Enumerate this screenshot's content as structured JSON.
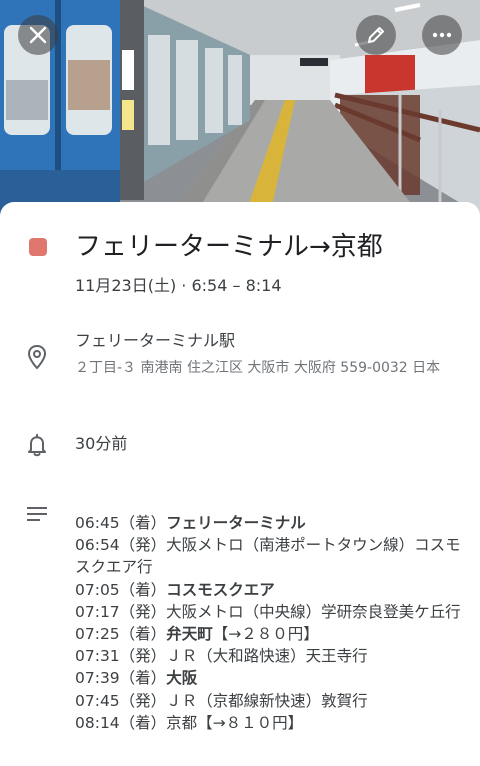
{
  "header": {
    "close_icon": "close-icon",
    "edit_icon": "pencil-icon",
    "more_icon": "more-horizontal-icon",
    "photo": "train-station-platform"
  },
  "event": {
    "color": "#e0776f",
    "title": "フェリーターミナル→京都",
    "datetime": "11月23日(土) · 6:54 – 8:14"
  },
  "location": {
    "icon": "location-pin-icon",
    "name": "フェリーターミナル駅",
    "address": "２丁目-３ 南港南 住之江区 大阪市 大阪府 559-0032 日本"
  },
  "reminder": {
    "icon": "bell-icon",
    "text": "30分前"
  },
  "description": {
    "icon": "notes-icon",
    "lines": [
      {
        "time": "06:45",
        "pre": "（着）",
        "bold": "フェリーターミナル",
        "rest": ""
      },
      {
        "time": "06:54",
        "pre": "（発）大阪メトロ（南港ポートタウン線）コスモスクエア行",
        "bold": "",
        "rest": ""
      },
      {
        "time": "07:05",
        "pre": "（着）",
        "bold": "コスモスクエア",
        "rest": ""
      },
      {
        "time": "07:17",
        "pre": "（発）大阪メトロ（中央線）学研奈良登美ケ丘行",
        "bold": "",
        "rest": ""
      },
      {
        "time": "07:25",
        "pre": "（着）",
        "bold": "弁天町",
        "rest": "【→２８０円】"
      },
      {
        "time": "07:31",
        "pre": "（発）ＪＲ（大和路快速）天王寺行",
        "bold": "",
        "rest": ""
      },
      {
        "time": "07:39",
        "pre": "（着）",
        "bold": "大阪",
        "rest": ""
      },
      {
        "time": "07:45",
        "pre": "（発）ＪＲ（京都線新快速）敦賀行",
        "bold": "",
        "rest": ""
      },
      {
        "time": "08:14",
        "pre": "（着）京都【→８１０円】",
        "bold": "",
        "rest": ""
      }
    ]
  }
}
